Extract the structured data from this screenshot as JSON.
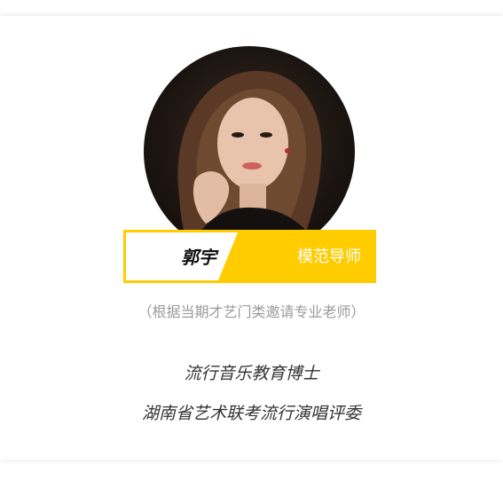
{
  "teacher": {
    "name": "郭宇",
    "title": "模范导师",
    "note": "（根据当期才艺门类邀请专业老师）",
    "credentials": [
      "流行音乐教育博士",
      "湖南省艺术联考流行演唱评委"
    ]
  },
  "colors": {
    "accent": "#ffcc00",
    "note_text": "#9a9a9a",
    "credential_text": "#333333"
  }
}
